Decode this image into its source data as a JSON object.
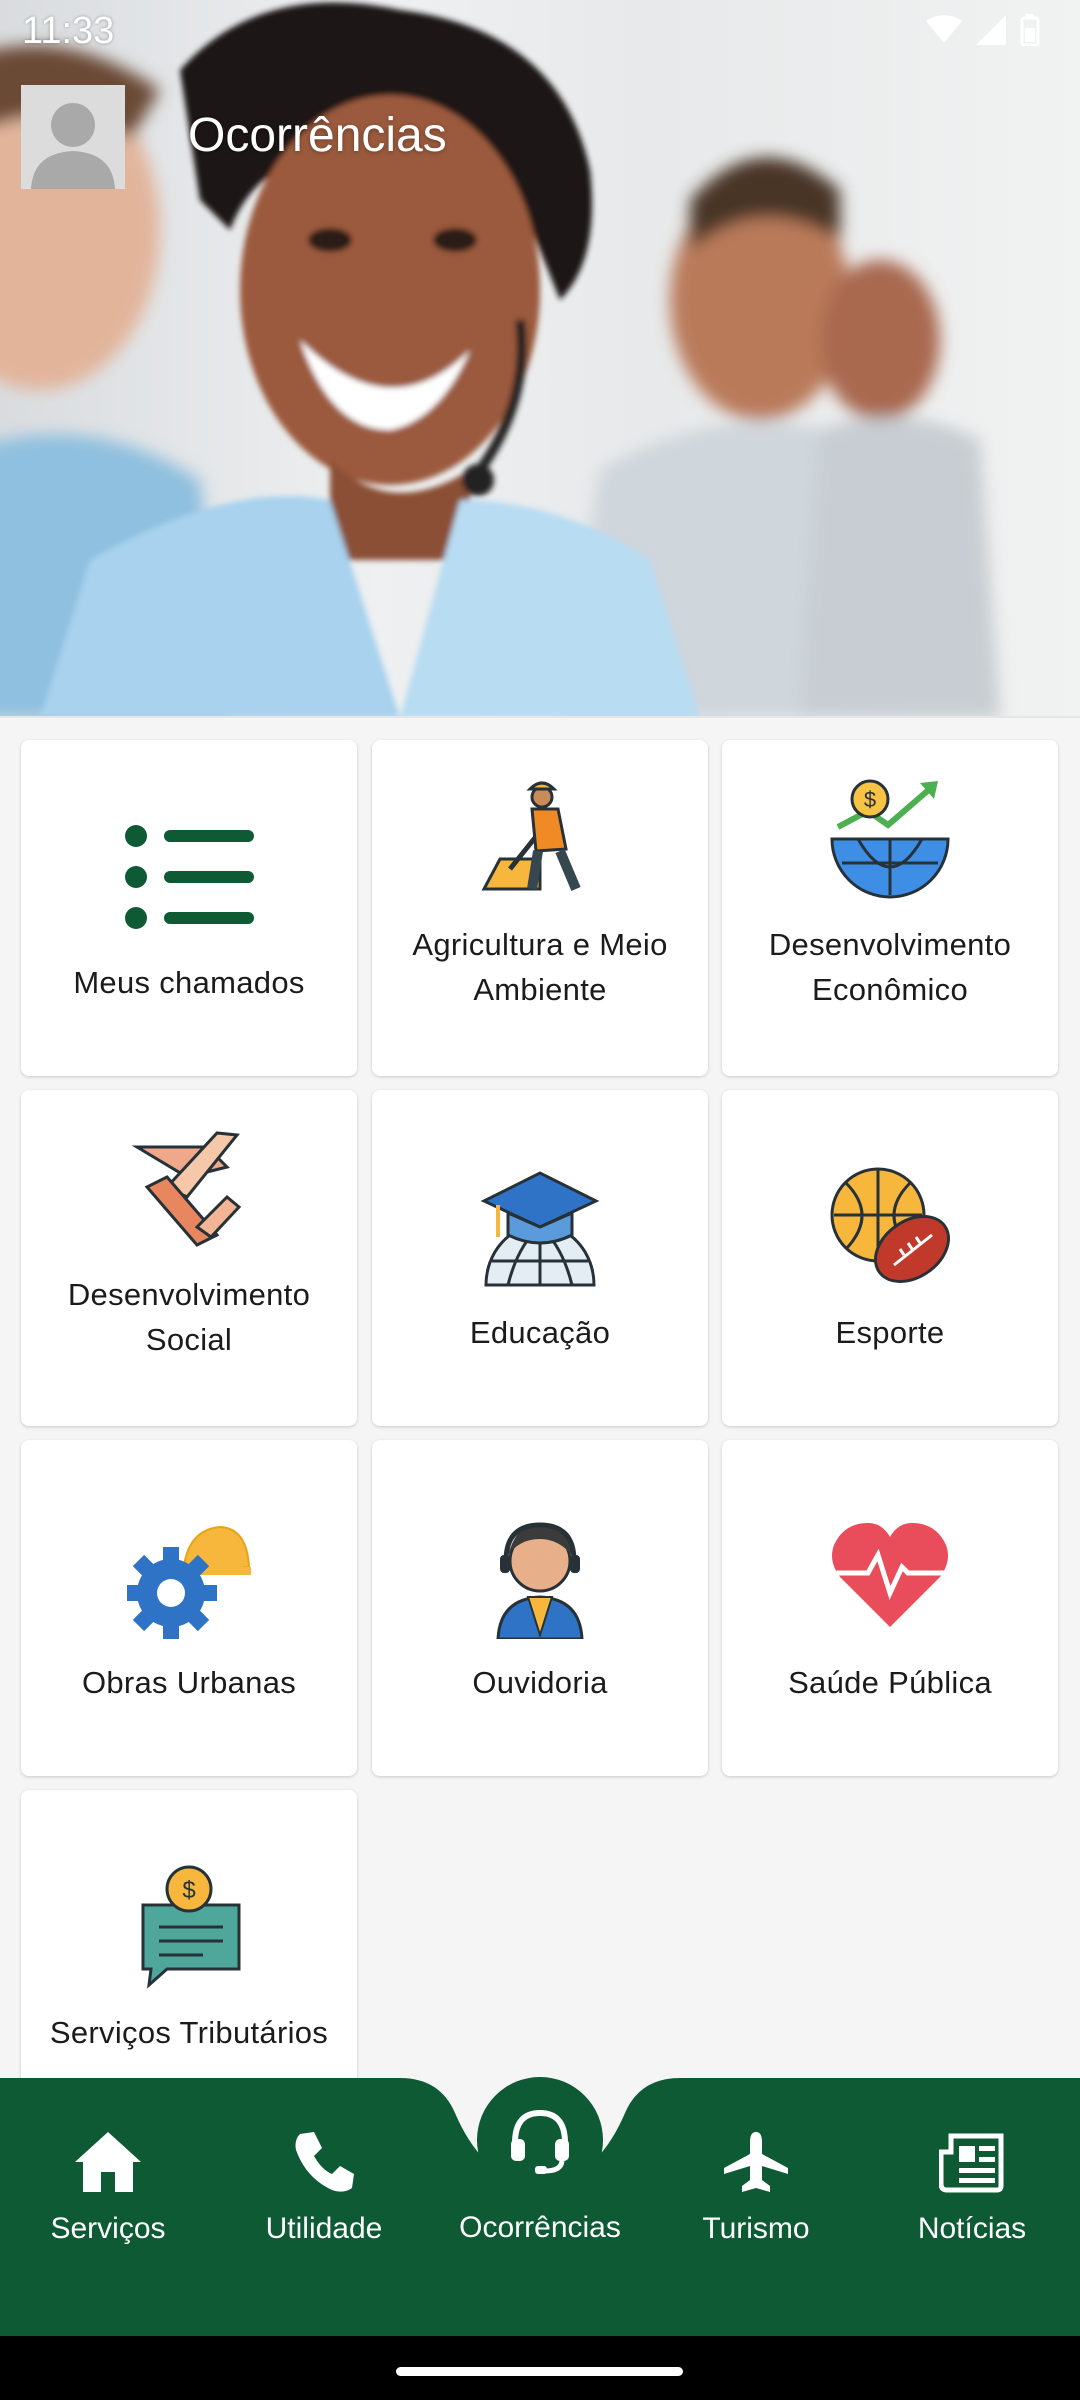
{
  "status": {
    "time": "11:33"
  },
  "header": {
    "title": "Ocorrências"
  },
  "categories": [
    {
      "label": "Meus chamados",
      "icon": "list-icon"
    },
    {
      "label": "Agricultura e Meio Ambiente",
      "icon": "worker-shovel-icon"
    },
    {
      "label": "Desenvolvimento Econômico",
      "icon": "globe-growth-icon"
    },
    {
      "label": "Desenvolvimento Social",
      "icon": "hands-together-icon"
    },
    {
      "label": "Educação",
      "icon": "graduation-globe-icon"
    },
    {
      "label": "Esporte",
      "icon": "sports-balls-icon"
    },
    {
      "label": "Obras Urbanas",
      "icon": "gear-helmet-icon"
    },
    {
      "label": "Ouvidoria",
      "icon": "call-agent-icon"
    },
    {
      "label": "Saúde Pública",
      "icon": "heart-pulse-icon"
    },
    {
      "label": "Serviços Tributários",
      "icon": "tax-document-icon"
    }
  ],
  "nav": {
    "items": [
      {
        "label": "Serviços",
        "icon": "home-icon"
      },
      {
        "label": "Utilidade",
        "icon": "phone-icon"
      },
      {
        "label": "Ocorrências",
        "icon": "headset-icon"
      },
      {
        "label": "Turismo",
        "icon": "airplane-icon"
      },
      {
        "label": "Notícias",
        "icon": "newspaper-icon"
      }
    ]
  },
  "colors": {
    "primary": "#0d5a34",
    "card": "#ffffff",
    "background": "#f5f5f5"
  }
}
